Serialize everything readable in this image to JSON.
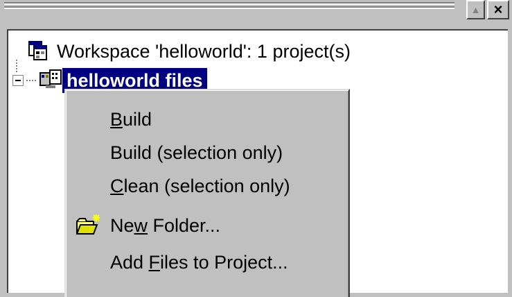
{
  "window": {
    "maximize_glyph": "▲",
    "close_glyph": "×"
  },
  "tree": {
    "workspace_label": "Workspace 'helloworld': 1 project(s)",
    "project_label": "helloworld files"
  },
  "menu": {
    "build": {
      "pre": "",
      "key": "B",
      "post": "uild"
    },
    "build_sel": {
      "label": "Build (selection only)"
    },
    "clean_sel": {
      "pre": "",
      "key": "C",
      "post": "lean (selection only)"
    },
    "new_folder": {
      "pre": "Ne",
      "key": "w",
      "post": " Folder..."
    },
    "add_files": {
      "pre": "Add ",
      "key": "F",
      "post": "iles to Project..."
    }
  },
  "colors": {
    "selection_bg": "#000080",
    "selection_fg": "#ffffff",
    "menu_bg": "#c0c0c0",
    "tree_bg": "#ffffff"
  },
  "icons": {
    "workspace": "workspace-icon",
    "project": "project-files-icon",
    "new_folder": "new-folder-icon"
  }
}
